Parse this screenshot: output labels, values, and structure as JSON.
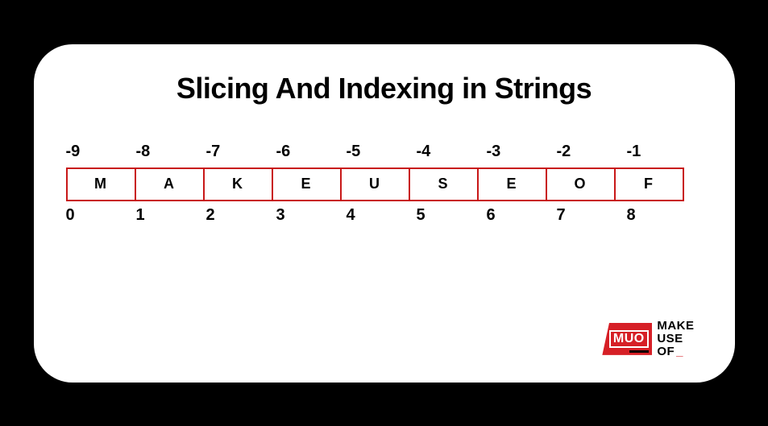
{
  "title": "Slicing And Indexing in Strings",
  "negative_indices": [
    "-9",
    "-8",
    "-7",
    "-6",
    "-5",
    "-4",
    "-3",
    "-2",
    "-1"
  ],
  "characters": [
    "M",
    "A",
    "K",
    "E",
    "U",
    "S",
    "E",
    "O",
    "F"
  ],
  "positive_indices": [
    "0",
    "1",
    "2",
    "3",
    "4",
    "5",
    "6",
    "7",
    "8"
  ],
  "logo": {
    "badge": "MUO",
    "line1": "MAKE",
    "line2": "USE",
    "line3": "OF",
    "cursor": "_"
  }
}
